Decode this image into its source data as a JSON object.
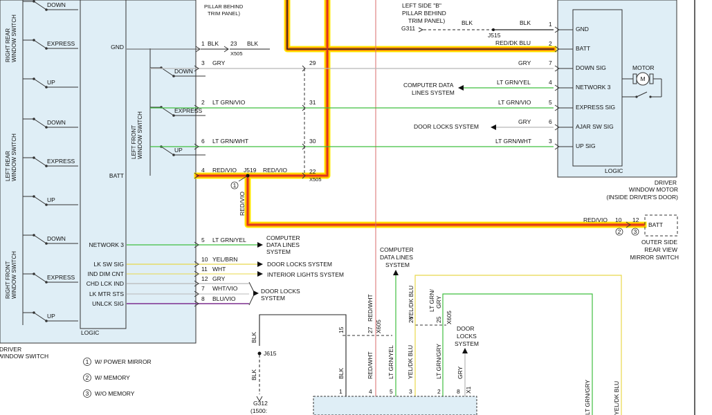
{
  "colors": {
    "panel_fill": "#dfeef6",
    "wire_black": "#222222",
    "wire_gray": "#b8b8b8",
    "wire_green": "#3fbf3f",
    "wire_yellow": "#e8d84a",
    "wire_purple": "#7b2d8e",
    "red_vio_core": "#d42a2a",
    "highlight_yellow": "#ffe800",
    "highlight_orange": "#ff7b00"
  },
  "left_switch": {
    "groups": [
      {
        "title": "RIGHT REAR WINDOW SWITCH",
        "positions": [
          "DOWN",
          "EXPRESS",
          "UP"
        ]
      },
      {
        "title": "LEFT REAR WINDOW SWITCH",
        "positions": [
          "DOWN",
          "EXPRESS",
          "UP"
        ]
      },
      {
        "title": "RIGHT FRONT WINDOW SWITCH",
        "positions": [
          "DOWN",
          "EXPRESS",
          "UP"
        ]
      }
    ],
    "left_front_title": "LEFT FRONT WINDOW SWITCH",
    "left_front_positions": [
      "DOWN",
      "EXPRESS",
      "UP"
    ],
    "terminals": [
      "GND",
      "BATT",
      "NETWORK 3",
      "LK SW SIG",
      "IND DIM CNT",
      "CHD LCK IND",
      "LK MTR STS",
      "UNLCK SIG"
    ],
    "logic_label": "LOGIC",
    "caption_line1": "DRIVER",
    "caption_line2": "WINDOW SWITCH"
  },
  "upper_wires": [
    {
      "pin": "1",
      "color": "BLK"
    },
    {
      "pin": "3",
      "color": "GRY"
    },
    {
      "pin": "2",
      "color": "LT GRN/VIO"
    },
    {
      "pin": "6",
      "color": "LT GRN/WHT"
    },
    {
      "pin": "4",
      "color": "RED/VIO"
    }
  ],
  "lower_wires": [
    {
      "pin": "5",
      "color": "LT GRN/YEL",
      "dest": "COMPUTER DATA LINES SYSTEM"
    },
    {
      "pin": "10",
      "color": "YEL/BRN",
      "dest": "DOOR LOCKS SYSTEM"
    },
    {
      "pin": "11",
      "color": "WHT",
      "dest": "INTERIOR LIGHTS SYSTEM"
    },
    {
      "pin": "12",
      "color": "GRY",
      "dest": ""
    },
    {
      "pin": "7",
      "color": "WHT/VIO",
      "dest": ""
    },
    {
      "pin": "8",
      "color": "BLU/VIO",
      "dest": ""
    }
  ],
  "door_locks_bracket": "DOOR LOCKS SYSTEM",
  "x505": {
    "name": "X505",
    "pins": [
      "23",
      "29",
      "31",
      "30",
      "22"
    ],
    "gnd_wire": "BLK",
    "batt_wire": "RED/VIO"
  },
  "splice_j519": "J519",
  "red_vio_vertical": "RED/VIO",
  "pillar_text": "PILLAR BEHIND TRIM PANEL)",
  "pillar_b": {
    "line1": "LEFT SIDE \"B\"",
    "line2": "PILLAR BEHIND",
    "line3": "TRIM PANEL)",
    "ground": "G311",
    "splice": "J515",
    "wire_left": "BLK",
    "wire_right": "BLK"
  },
  "motor_wires": [
    {
      "pin": "1",
      "color": "BLK",
      "dest": ""
    },
    {
      "pin": "2",
      "color": "RED/DK BLU",
      "dest": ""
    },
    {
      "pin": "7",
      "color": "GRY",
      "dest": ""
    },
    {
      "pin": "4",
      "color": "LT GRN/YEL",
      "dest": "COMPUTER DATA LINES SYSTEM"
    },
    {
      "pin": "5",
      "color": "LT GRN/VIO",
      "dest": ""
    },
    {
      "pin": "6",
      "color": "GRY",
      "dest": "DOOR LOCKS SYSTEM"
    },
    {
      "pin": "3",
      "color": "LT GRN/WHT",
      "dest": ""
    }
  ],
  "motor_module": {
    "terminals": [
      "GND",
      "BATT",
      "DOWN SIG",
      "NETWORK 3",
      "EXPRESS SIG",
      "AJAR SW SIG",
      "UP SIG"
    ],
    "motor_label": "MOTOR",
    "motor_symbol": "M",
    "logic_label": "LOGIC",
    "caption_line1": "DRIVER",
    "caption_line2": "WINDOW MOTOR",
    "caption_line3": "(INSIDE DRIVER'S DOOR)"
  },
  "mirror_feed": {
    "wire": "RED/VIO",
    "pin_left": "10",
    "pin_right": "12",
    "batt_label": "BATT",
    "note_left": "2",
    "note_right": "3",
    "caption_line1": "OUTER SIDE",
    "caption_line2": "REAR VIEW",
    "caption_line3": "MIRROR SWITCH"
  },
  "note_j519": "1",
  "legend": [
    {
      "num": "1",
      "text": "W/ POWER MIRROR"
    },
    {
      "num": "2",
      "text": "W/ MEMORY"
    },
    {
      "num": "3",
      "text": "W/O MEMORY"
    }
  ],
  "bottom": {
    "blk_top": "BLK",
    "splice": "J615",
    "blk_bottom": "BLK",
    "ground": "G312",
    "ground_sub": "(1500:",
    "computer_data_lines": "COMPUTER DATA LINES SYSTEM",
    "door_locks": "DOOR LOCKS SYSTEM",
    "upper_pins": [
      "15",
      "27",
      "26",
      "25"
    ],
    "x605": "X605",
    "vertical_labels": [
      "BLK",
      "RED/WHT",
      "LT GRN/YEL",
      "YEL/DK BLU",
      "LT GRN/GRY",
      "GRY",
      "LT GRN/GRY",
      "YEL/DK BLU"
    ],
    "red_wht_top": "RED/WHT",
    "yel_dk_blu_top": "YEL/DK BLU",
    "lt_grn_gry_top": "LT GRN/ GRY",
    "bottom_pins": [
      "1",
      "4",
      "5",
      "3",
      "2",
      "8"
    ],
    "x1": "X1"
  }
}
